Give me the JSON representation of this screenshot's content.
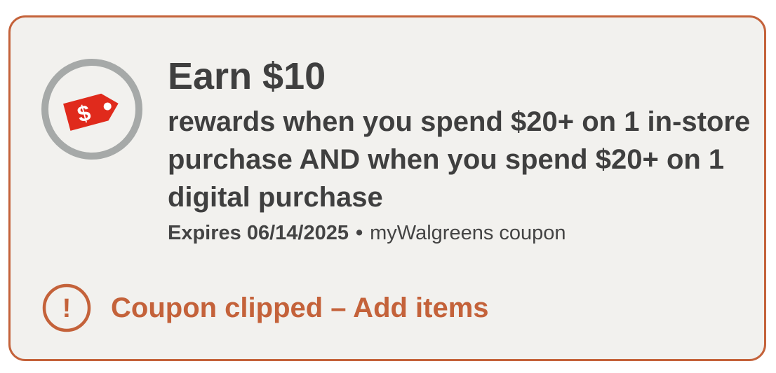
{
  "coupon": {
    "title": "Earn $10",
    "description": "rewards when you spend $20+ on 1 in-store purchase AND when you spend $20+ on 1 digital purchase",
    "expires": "Expires 06/14/2025",
    "separator": "•",
    "source": "myWalgreens coupon",
    "icon": "price-tag-icon",
    "icon_symbol": "$"
  },
  "status": {
    "label": "Coupon clipped – Add items",
    "icon": "alert-circle-icon",
    "icon_symbol": "!"
  },
  "colors": {
    "accent": "#c4623a",
    "card_background": "#f2f1ee",
    "text": "#3f3f3f",
    "tag_red": "#e02a1c",
    "ring_gray": "#a6a9a8"
  }
}
